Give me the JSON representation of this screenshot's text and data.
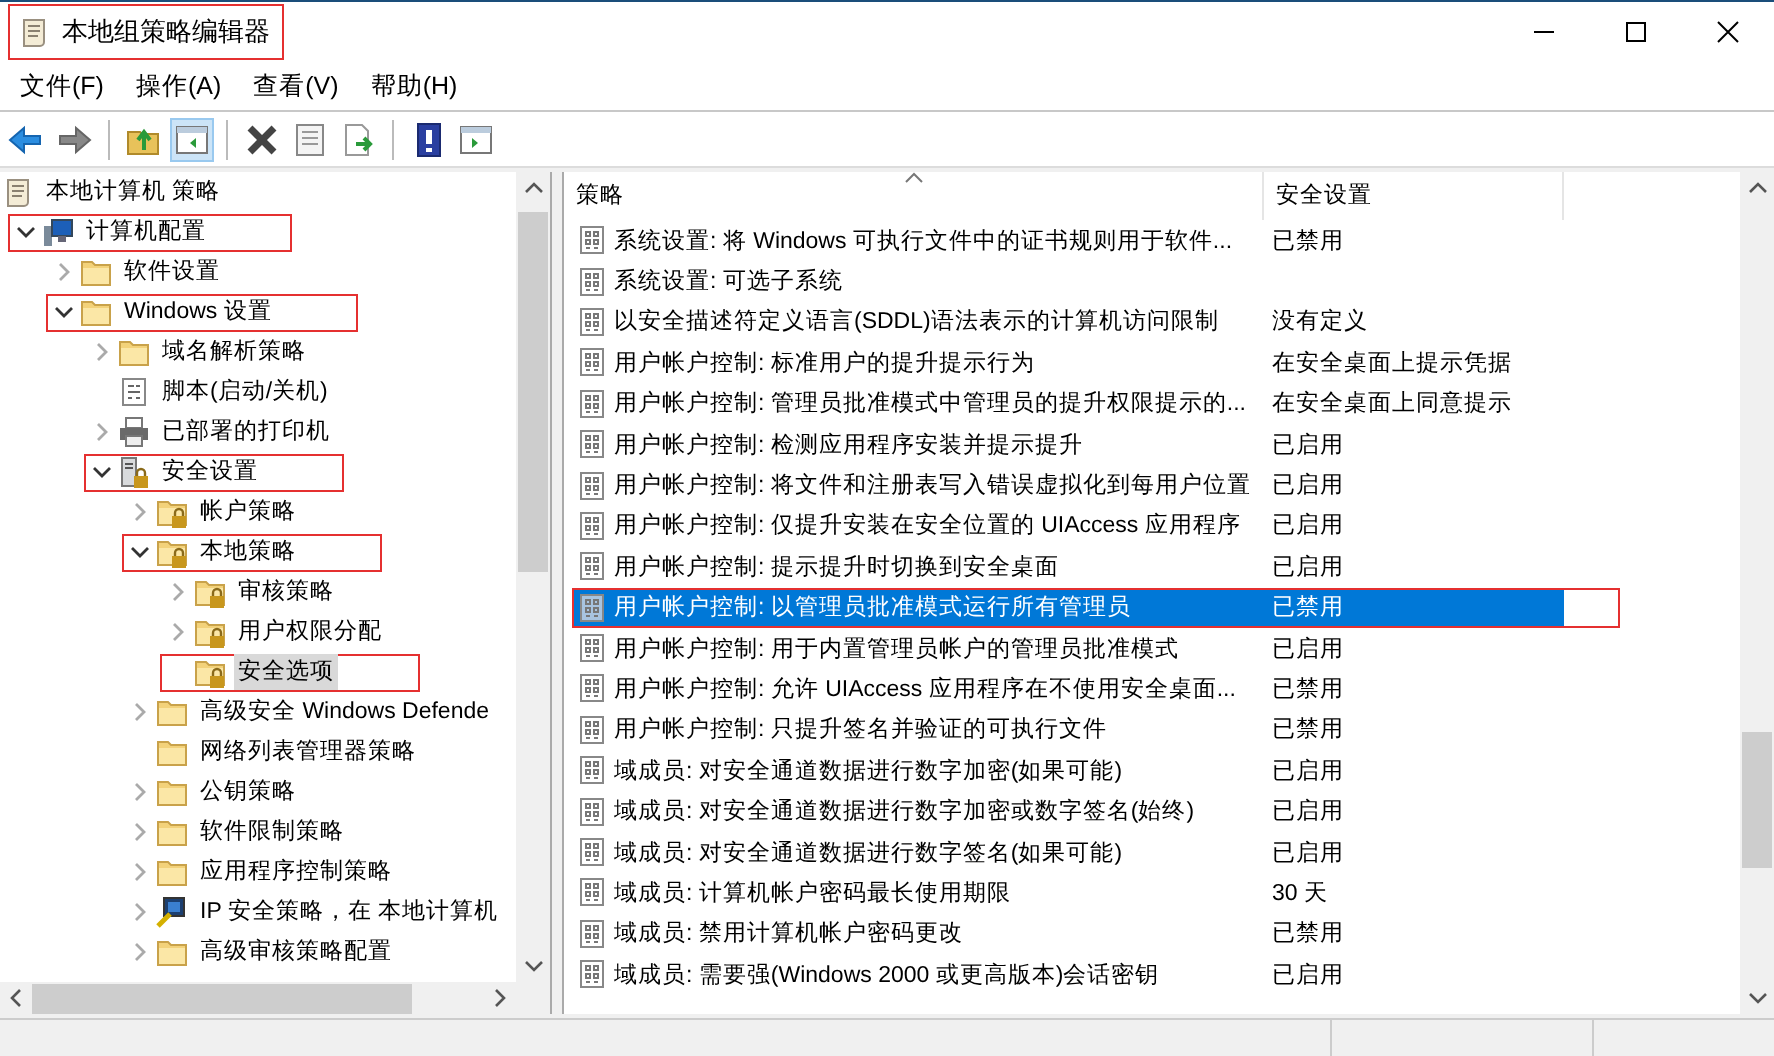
{
  "window": {
    "title": "本地组策略编辑器",
    "annotated": true
  },
  "menu": [
    "文件(F)",
    "操作(A)",
    "查看(V)",
    "帮助(H)"
  ],
  "toolbar": [
    {
      "kind": "back",
      "disabled": false
    },
    {
      "kind": "forward",
      "disabled": true
    },
    {
      "kind": "separator"
    },
    {
      "kind": "up"
    },
    {
      "kind": "tree",
      "pressed": true
    },
    {
      "kind": "separator"
    },
    {
      "kind": "delete"
    },
    {
      "kind": "properties"
    },
    {
      "kind": "export"
    },
    {
      "kind": "separator"
    },
    {
      "kind": "help"
    },
    {
      "kind": "action-pane"
    }
  ],
  "tree": [
    {
      "label": "本地计算机 策略",
      "kind": "scroll",
      "selected": false,
      "annotated": false,
      "children": [
        {
          "label": "计算机配置",
          "kind": "computer",
          "expanded": true,
          "selected": false,
          "annotated": true,
          "children": [
            {
              "label": "软件设置",
              "kind": "folder",
              "expanded": false,
              "selected": false,
              "annotated": false
            },
            {
              "label": "Windows 设置",
              "kind": "folder",
              "expanded": true,
              "selected": false,
              "annotated": true,
              "children": [
                {
                  "label": "域名解析策略",
                  "kind": "folder",
                  "expanded": false,
                  "selected": false,
                  "annotated": false
                },
                {
                  "label": "脚本(启动/关机)",
                  "kind": "script",
                  "selected": false,
                  "annotated": false
                },
                {
                  "label": "已部署的打印机",
                  "kind": "printer",
                  "expanded": false,
                  "selected": false,
                  "annotated": false
                },
                {
                  "label": "安全设置",
                  "kind": "server",
                  "expanded": true,
                  "selected": false,
                  "annotated": true,
                  "children": [
                    {
                      "label": "帐户策略",
                      "kind": "lockfolder",
                      "expanded": false,
                      "selected": false,
                      "annotated": false
                    },
                    {
                      "label": "本地策略",
                      "kind": "lockfolder",
                      "expanded": true,
                      "selected": false,
                      "annotated": true,
                      "children": [
                        {
                          "label": "审核策略",
                          "kind": "lockfolder",
                          "expanded": false,
                          "selected": false,
                          "annotated": false
                        },
                        {
                          "label": "用户权限分配",
                          "kind": "lockfolder",
                          "expanded": false,
                          "selected": false,
                          "annotated": false
                        },
                        {
                          "label": "安全选项",
                          "kind": "lockfolder",
                          "selected": true,
                          "annotated": true
                        }
                      ]
                    },
                    {
                      "label": "高级安全 Windows Defende",
                      "kind": "folder",
                      "expanded": false,
                      "selected": false,
                      "annotated": false
                    },
                    {
                      "label": "网络列表管理器策略",
                      "kind": "folder",
                      "selected": false,
                      "annotated": false
                    },
                    {
                      "label": "公钥策略",
                      "kind": "folder",
                      "expanded": false,
                      "selected": false,
                      "annotated": false
                    },
                    {
                      "label": "软件限制策略",
                      "kind": "folder",
                      "expanded": false,
                      "selected": false,
                      "annotated": false
                    },
                    {
                      "label": "应用程序控制策略",
                      "kind": "folder",
                      "expanded": false,
                      "selected": false,
                      "annotated": false
                    },
                    {
                      "label": "IP 安全策略，在 本地计算机",
                      "kind": "ip",
                      "expanded": false,
                      "selected": false,
                      "annotated": false
                    },
                    {
                      "label": "高级审核策略配置",
                      "kind": "folder",
                      "expanded": false,
                      "selected": false,
                      "annotated": false
                    }
                  ]
                }
              ]
            }
          ]
        }
      ]
    }
  ],
  "table": {
    "columns": [
      "策略",
      "安全设置"
    ],
    "rows": [
      {
        "policy": "系统设置: 将 Windows 可执行文件中的证书规则用于软件...",
        "setting": "已禁用",
        "selected": false,
        "annotated": false
      },
      {
        "policy": "系统设置: 可选子系统",
        "selected": false,
        "annotated": false
      },
      {
        "policy": "以安全描述符定义语言(SDDL)语法表示的计算机访问限制",
        "setting": "没有定义",
        "selected": false,
        "annotated": false
      },
      {
        "policy": "用户帐户控制: 标准用户的提升提示行为",
        "setting": "在安全桌面上提示凭据",
        "selected": false,
        "annotated": false
      },
      {
        "policy": "用户帐户控制: 管理员批准模式中管理员的提升权限提示的...",
        "setting": "在安全桌面上同意提示",
        "selected": false,
        "annotated": false
      },
      {
        "policy": "用户帐户控制: 检测应用程序安装并提示提升",
        "setting": "已启用",
        "selected": false,
        "annotated": false
      },
      {
        "policy": "用户帐户控制: 将文件和注册表写入错误虚拟化到每用户位置",
        "setting": "已启用",
        "selected": false,
        "annotated": false
      },
      {
        "policy": "用户帐户控制: 仅提升安装在安全位置的 UIAccess 应用程序",
        "setting": "已启用",
        "selected": false,
        "annotated": false
      },
      {
        "policy": "用户帐户控制: 提示提升时切换到安全桌面",
        "setting": "已启用",
        "selected": false,
        "annotated": false
      },
      {
        "policy": "用户帐户控制: 以管理员批准模式运行所有管理员",
        "setting": "已禁用",
        "selected": true,
        "annotated": true
      },
      {
        "policy": "用户帐户控制: 用于内置管理员帐户的管理员批准模式",
        "setting": "已启用",
        "selected": false,
        "annotated": false
      },
      {
        "policy": "用户帐户控制: 允许 UIAccess 应用程序在不使用安全桌面...",
        "setting": "已禁用",
        "selected": false,
        "annotated": false
      },
      {
        "policy": "用户帐户控制: 只提升签名并验证的可执行文件",
        "setting": "已禁用",
        "selected": false,
        "annotated": false
      },
      {
        "policy": "域成员: 对安全通道数据进行数字加密(如果可能)",
        "setting": "已启用",
        "selected": false,
        "annotated": false
      },
      {
        "policy": "域成员: 对安全通道数据进行数字加密或数字签名(始终)",
        "setting": "已启用",
        "selected": false,
        "annotated": false
      },
      {
        "policy": "域成员: 对安全通道数据进行数字签名(如果可能)",
        "setting": "已启用",
        "selected": false,
        "annotated": false
      },
      {
        "policy": "域成员: 计算机帐户密码最长使用期限",
        "setting": "30 天",
        "selected": false,
        "annotated": false
      },
      {
        "policy": "域成员: 禁用计算机帐户密码更改",
        "setting": "已禁用",
        "selected": false,
        "annotated": false
      },
      {
        "policy": "域成员: 需要强(Windows 2000 或更高版本)会话密钥",
        "setting": "已启用",
        "selected": false,
        "annotated": false
      }
    ]
  }
}
